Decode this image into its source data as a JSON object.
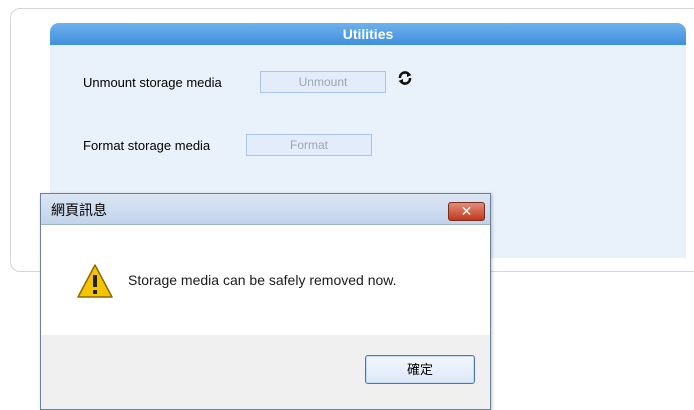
{
  "utilities": {
    "title": "Utilities",
    "unmount_label": "Unmount storage media",
    "unmount_button": "Unmount",
    "format_label": "Format storage media",
    "format_button": "Format",
    "refresh_icon": "refresh-icon"
  },
  "dialog": {
    "title": "網頁訊息",
    "message": "Storage media can be safely removed now.",
    "ok_button": "確定",
    "close_icon": "close-icon",
    "warning_icon": "warning-icon"
  },
  "colors": {
    "header_blue": "#3f8fdc",
    "panel_bg": "#e9f1fb",
    "close_red": "#c2381d",
    "warning_yellow": "#f5c400"
  }
}
